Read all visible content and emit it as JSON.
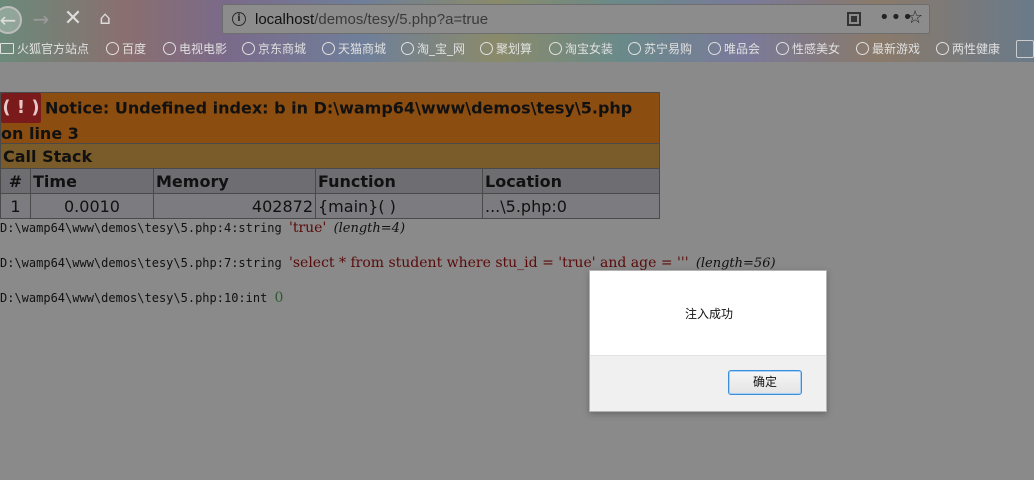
{
  "browser": {
    "url_host": "localhost",
    "url_path": "/demos/tesy/5.php?a=true",
    "nav_icons": [
      "back-arrow-icon",
      "forward-arrow-icon",
      "stop-x-icon",
      "home-icon"
    ],
    "bookmarks": [
      "火狐官方站点",
      "百度",
      "电视电影",
      "京东商城",
      "天猫商城",
      "淘_宝_网",
      "聚划算",
      "淘宝女装",
      "苏宁易购",
      "唯品会",
      "性感美女",
      "最新游戏",
      "两性健康"
    ]
  },
  "notice": {
    "icon_text": "( ! )",
    "message": "Notice: Undefined index: b in D:\\wamp64\\www\\demos\\tesy\\5.php on line 3"
  },
  "callstack": {
    "title": "Call Stack",
    "headers": [
      "#",
      "Time",
      "Memory",
      "Function",
      "Location"
    ],
    "rows": [
      [
        "1",
        "0.0010",
        "402872",
        "{main}( )",
        "...\\5.php:0"
      ]
    ]
  },
  "dumps": [
    {
      "prefix": "D:\\wamp64\\www\\demos\\tesy\\5.php:4:string",
      "value": "'true'",
      "length": "(length=4)"
    },
    {
      "prefix": "D:\\wamp64\\www\\demos\\tesy\\5.php:7:string",
      "value": "'select * from student where stu_id = 'true' and age = '''",
      "length": "(length=56)"
    },
    {
      "prefix": "D:\\wamp64\\www\\demos\\tesy\\5.php:10:int",
      "value": "0"
    }
  ],
  "dialog": {
    "message": "注入成功",
    "ok_label": "确定"
  }
}
